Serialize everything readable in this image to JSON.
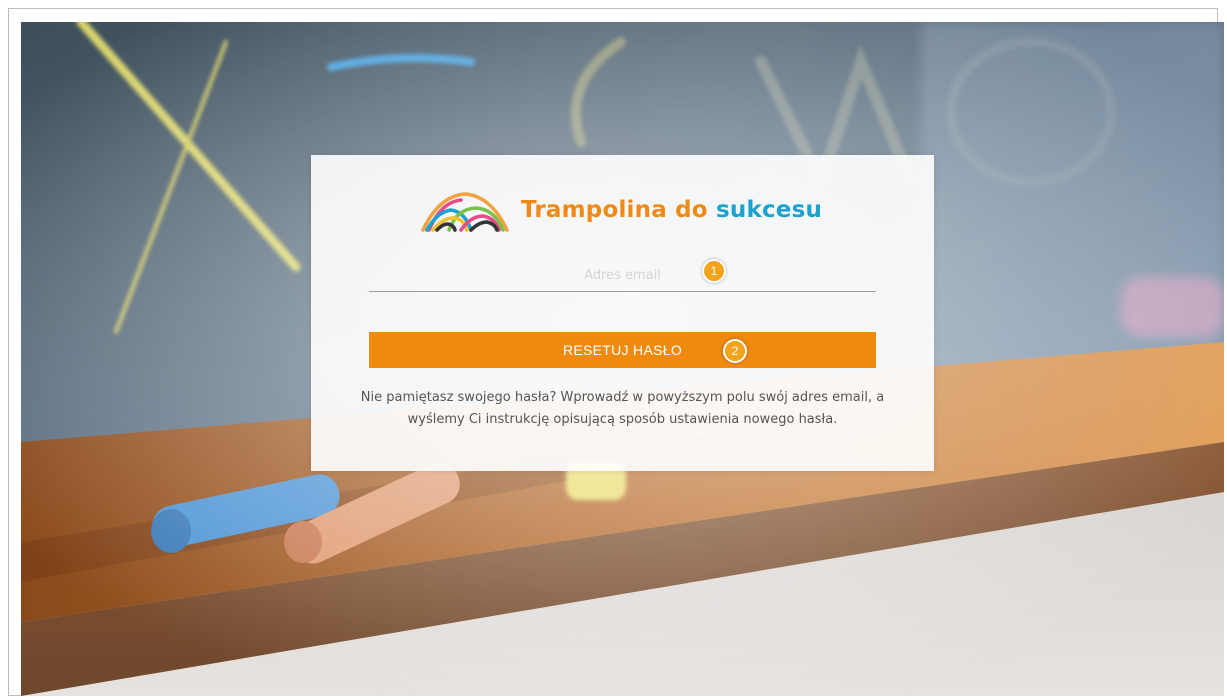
{
  "brand": {
    "word1": "Trampolina do",
    "word2": "sukcesu",
    "logo_icon": "rainbow-arches-logo-icon",
    "colors": {
      "orange": "#ef8a17",
      "blue": "#1aa3cf"
    }
  },
  "form": {
    "email_placeholder": "Adres email",
    "email_value": "",
    "submit_label": "RESETUJ HASŁO",
    "button_color": "#ef8a0f",
    "help_text": "Nie pamiętasz swojego hasła? Wprowadź w powyższym polu swój adres email, a wyślemy Ci instrukcję opisującą sposób ustawienia nowego hasła."
  },
  "annotations": [
    {
      "label": "1",
      "color": "#f4a31c"
    },
    {
      "label": "2",
      "color": "#f4a31c"
    }
  ]
}
